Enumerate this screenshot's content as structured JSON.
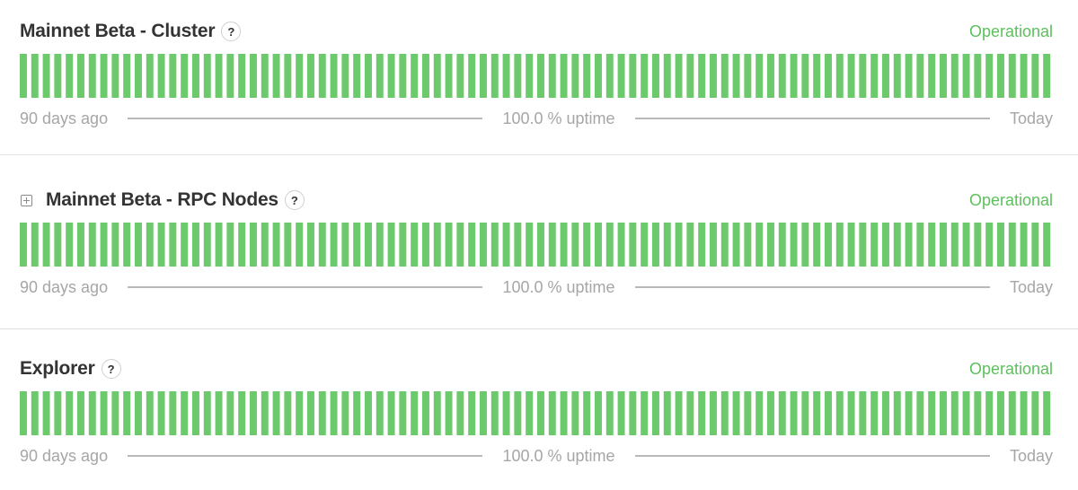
{
  "components": [
    {
      "name": "Mainnet Beta - Cluster",
      "has_expand": false,
      "status": "Operational",
      "uptime": "100.0 % uptime",
      "start_label": "90 days ago",
      "end_label": "Today",
      "help_glyph": "?",
      "day_count": 90,
      "day_status": "operational"
    },
    {
      "name": "Mainnet Beta - RPC Nodes",
      "has_expand": true,
      "status": "Operational",
      "uptime": "100.0 % uptime",
      "start_label": "90 days ago",
      "end_label": "Today",
      "help_glyph": "?",
      "day_count": 90,
      "day_status": "operational"
    },
    {
      "name": "Explorer",
      "has_expand": false,
      "status": "Operational",
      "uptime": "100.0 % uptime",
      "start_label": "90 days ago",
      "end_label": "Today",
      "help_glyph": "?",
      "day_count": 90,
      "day_status": "operational"
    }
  ],
  "colors": {
    "operational": "#6cc96c",
    "status_text": "#5cc05c",
    "muted_text": "#a6a6a6",
    "title_text": "#333333"
  },
  "icons": {
    "expand": "plus-square-icon",
    "help": "question-circle-icon"
  }
}
